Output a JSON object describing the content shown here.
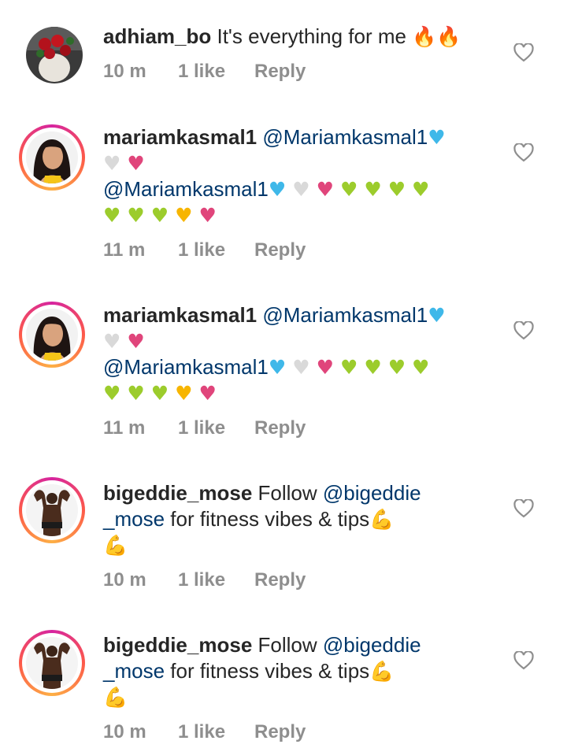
{
  "comments": [
    {
      "username": "adhiam_bo",
      "segments": [
        {
          "kind": "text",
          "value": " It's everything for me "
        },
        {
          "kind": "emoji",
          "value": "🔥",
          "icon": "fire-icon",
          "color": "#f06a1c"
        },
        {
          "kind": "emoji",
          "value": "🔥",
          "icon": "fire-icon",
          "color": "#f06a1c"
        }
      ],
      "time": "10 m",
      "likes": "1 like",
      "reply": "Reply",
      "avatar": "roses-photo",
      "story_ring": false
    },
    {
      "username": "mariamkasmal1",
      "line1_mention": " @Mariamkasmal1",
      "line2_mention": "@Mariamkasmal1",
      "hearts_line1": [
        "blue"
      ],
      "hearts_line1b": [
        "white",
        "pink"
      ],
      "hearts_line2": [
        "blue",
        "white",
        "pink",
        "green",
        "green",
        "green",
        "green"
      ],
      "hearts_line3": [
        "green",
        "green",
        "green",
        "yellow",
        "sparkling-pink"
      ],
      "time": "11 m",
      "likes": "1 like",
      "reply": "Reply",
      "avatar": "woman-portrait",
      "story_ring": true
    },
    {
      "username": "mariamkasmal1",
      "line1_mention": " @Mariamkasmal1",
      "line2_mention": "@Mariamkasmal1",
      "time": "11 m",
      "likes": "1 like",
      "reply": "Reply",
      "avatar": "woman-portrait",
      "story_ring": true
    },
    {
      "username": "bigeddie_mose",
      "text_before": " Follow ",
      "mention_a": "@bigeddie",
      "mention_b": "_mose",
      "text_after": " for fitness vibes & tips",
      "emoji": "💪",
      "time": "10 m",
      "likes": "1 like",
      "reply": "Reply",
      "avatar": "man-flexing",
      "story_ring": true
    },
    {
      "username": "bigeddie_mose",
      "text_before": " Follow ",
      "mention_a": "@bigeddie",
      "mention_b": "_mose",
      "text_after": " for fitness vibes & tips",
      "emoji": "💪",
      "time": "10 m",
      "likes": "1 like",
      "reply": "Reply",
      "avatar": "man-flexing",
      "story_ring": true
    }
  ],
  "colors": {
    "username": "#262626",
    "mention": "#00376b",
    "meta": "#8e8e8e",
    "heart_blue": "#3fb8e9",
    "heart_white": "#d9d9d9",
    "heart_pink": "#e0457b",
    "heart_green": "#9ccc2c",
    "heart_yellow": "#f7b500"
  }
}
